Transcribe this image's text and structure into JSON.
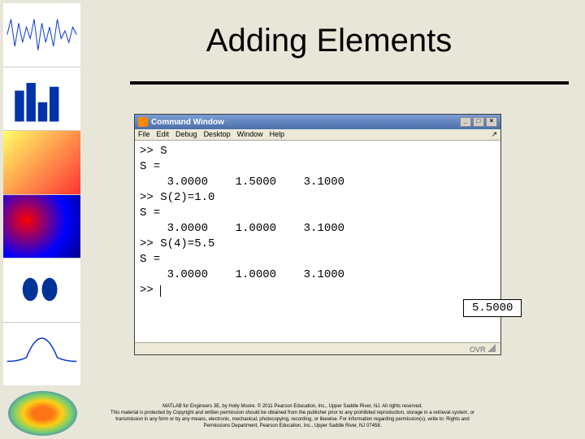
{
  "title": "Adding Elements",
  "window": {
    "title": "Command Window",
    "menus": [
      "File",
      "Edit",
      "Debug",
      "Desktop",
      "Window",
      "Help"
    ],
    "minimize": "_",
    "maximize": "□",
    "close": "×",
    "pin": "↗",
    "status": "OVR"
  },
  "lines": {
    "l1": ">> S",
    "l2": "S =",
    "l3": "    3.0000    1.5000    3.1000",
    "l4": ">> S(2)=1.0",
    "l5": "S =",
    "l6": "    3.0000    1.0000    3.1000",
    "l7": ">> S(4)=5.5",
    "l8": "S =",
    "l9": "    3.0000    1.0000    3.1000",
    "l10": ">> "
  },
  "highlight": "5.5000",
  "footer": {
    "l1": "MATLAB for Engineers 3E, by Holly Moore. © 2011 Pearson Education, Inc., Upper Saddle River, NJ. All rights reserved.",
    "l2": "This material is protected by Copyright and written permission should be obtained from the publisher prior to any prohibited reproduction, storage in a retrieval system, or",
    "l3": "transmission in any form or by any means, electronic, mechanical, photocopying, recording, or likewise. For information regarding permission(s), write to: Rights and",
    "l4": "Permissions Department, Pearson Education, Inc., Upper Saddle River, NJ 07458."
  }
}
